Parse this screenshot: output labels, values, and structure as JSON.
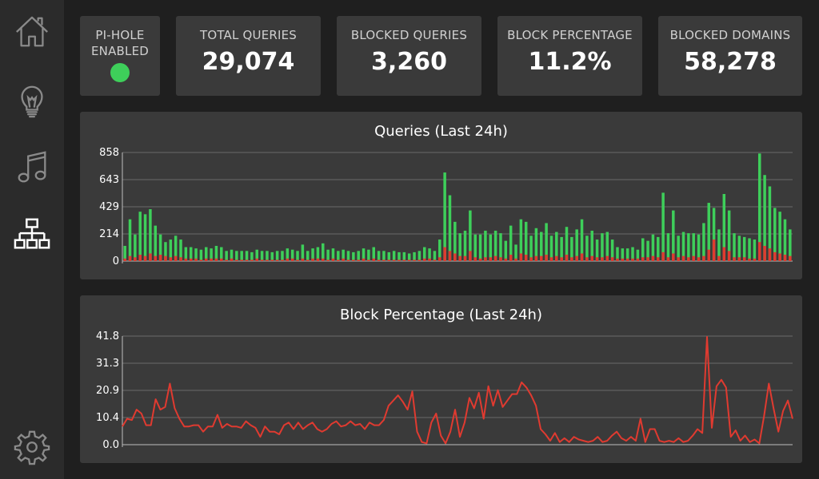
{
  "nav": {
    "items": [
      {
        "name": "home-icon"
      },
      {
        "name": "lightbulb-icon"
      },
      {
        "name": "music-icon"
      },
      {
        "name": "network-icon"
      },
      {
        "name": "gear-icon"
      }
    ]
  },
  "stats": {
    "enabled_label": "PI-HOLE\nENABLED",
    "status_color": "#3ecf5a",
    "total_label": "TOTAL QUERIES",
    "total_value": "29,074",
    "blocked_label": "BLOCKED QUERIES",
    "blocked_value": "3,260",
    "pct_label": "BLOCK PERCENTAGE",
    "pct_value": "11.2%",
    "domains_label": "BLOCKED DOMAINS",
    "domains_value": "58,278"
  },
  "chart_data": [
    {
      "type": "bar",
      "title": "Queries (Last 24h)",
      "ylim": [
        0,
        858
      ],
      "yticks": [
        "858",
        "643",
        "429",
        "214",
        "0"
      ],
      "colors": {
        "total": "#3ecf5a",
        "blocked": "#e03a30"
      },
      "series": [
        {
          "name": "total",
          "values": [
            120,
            330,
            210,
            390,
            370,
            410,
            280,
            210,
            150,
            170,
            200,
            170,
            110,
            110,
            100,
            90,
            110,
            100,
            120,
            110,
            80,
            90,
            80,
            80,
            80,
            70,
            90,
            80,
            80,
            70,
            80,
            80,
            100,
            90,
            80,
            130,
            80,
            100,
            110,
            140,
            90,
            100,
            80,
            90,
            80,
            70,
            80,
            100,
            90,
            110,
            80,
            80,
            70,
            80,
            70,
            70,
            60,
            70,
            80,
            110,
            100,
            80,
            170,
            700,
            520,
            310,
            220,
            240,
            400,
            210,
            210,
            240,
            210,
            240,
            220,
            160,
            280,
            130,
            330,
            310,
            200,
            260,
            230,
            300,
            200,
            230,
            190,
            270,
            190,
            250,
            330,
            200,
            240,
            170,
            220,
            230,
            170,
            110,
            100,
            100,
            110,
            90,
            180,
            160,
            210,
            190,
            540,
            220,
            400,
            200,
            230,
            220,
            220,
            210,
            300,
            460,
            420,
            250,
            530,
            400,
            220,
            200,
            190,
            180,
            170,
            850,
            680,
            590,
            420,
            390,
            330,
            250
          ]
        },
        {
          "name": "blocked",
          "values": [
            20,
            40,
            30,
            50,
            40,
            60,
            40,
            50,
            40,
            30,
            40,
            30,
            20,
            20,
            20,
            10,
            20,
            20,
            20,
            20,
            10,
            20,
            10,
            10,
            10,
            10,
            20,
            10,
            10,
            10,
            10,
            10,
            20,
            20,
            10,
            20,
            10,
            20,
            20,
            20,
            10,
            20,
            10,
            20,
            10,
            10,
            10,
            20,
            10,
            20,
            10,
            10,
            10,
            10,
            10,
            10,
            10,
            10,
            10,
            20,
            20,
            10,
            30,
            110,
            80,
            60,
            40,
            40,
            80,
            30,
            20,
            30,
            30,
            40,
            30,
            20,
            50,
            20,
            60,
            50,
            30,
            40,
            40,
            50,
            30,
            40,
            30,
            50,
            30,
            40,
            60,
            30,
            40,
            30,
            30,
            40,
            30,
            20,
            20,
            20,
            20,
            20,
            30,
            30,
            40,
            30,
            70,
            30,
            60,
            30,
            40,
            30,
            40,
            30,
            40,
            90,
            170,
            40,
            110,
            80,
            30,
            30,
            30,
            20,
            20,
            150,
            120,
            100,
            70,
            60,
            50,
            40
          ]
        }
      ]
    },
    {
      "type": "line",
      "title": "Block Percentage (Last 24h)",
      "ylim": [
        0,
        41.8
      ],
      "yticks": [
        "41.8",
        "31.3",
        "20.9",
        "10.4",
        "0.0"
      ],
      "color": "#e03a30",
      "series": [
        {
          "name": "block_pct",
          "values": [
            7.0,
            10.0,
            9.5,
            13.5,
            12.0,
            7.5,
            7.5,
            17.5,
            13.5,
            14.5,
            23.5,
            14.0,
            10.0,
            7.0,
            7.0,
            7.5,
            7.5,
            5.0,
            7.0,
            7.0,
            11.5,
            6.5,
            8.0,
            7.0,
            7.0,
            6.5,
            9.0,
            7.5,
            6.5,
            3.0,
            7.0,
            5.0,
            5.0,
            4.0,
            7.5,
            8.5,
            6.0,
            8.5,
            6.0,
            7.5,
            8.5,
            6.0,
            5.0,
            6.0,
            8.0,
            9.0,
            7.0,
            7.5,
            9.0,
            7.5,
            8.0,
            6.0,
            8.5,
            7.5,
            7.5,
            9.5,
            15.0,
            17.0,
            19.0,
            16.5,
            13.5,
            20.5,
            5.0,
            1.0,
            0.5,
            8.5,
            12.0,
            3.5,
            0.5,
            5.0,
            13.5,
            3.0,
            8.5,
            18.0,
            14.0,
            20.0,
            10.0,
            22.5,
            15.0,
            21.0,
            14.5,
            17.0,
            19.5,
            19.5,
            24.0,
            22.0,
            19.0,
            15.0,
            6.0,
            4.0,
            1.5,
            4.5,
            1.0,
            2.5,
            1.0,
            3.0,
            2.0,
            1.5,
            1.0,
            1.5,
            3.0,
            1.0,
            1.5,
            3.5,
            5.0,
            2.5,
            1.5,
            3.0,
            1.5,
            10.0,
            1.0,
            6.0,
            6.0,
            1.5,
            1.0,
            1.5,
            1.0,
            2.5,
            1.0,
            1.5,
            3.5,
            6.0,
            4.5,
            41.5,
            6.5,
            22.5,
            25.0,
            22.0,
            3.0,
            5.5,
            1.5,
            3.5,
            1.0,
            2.0,
            0.5,
            11.0,
            23.5,
            14.0,
            5.0,
            13.0,
            17.0,
            10.0
          ]
        }
      ]
    }
  ]
}
